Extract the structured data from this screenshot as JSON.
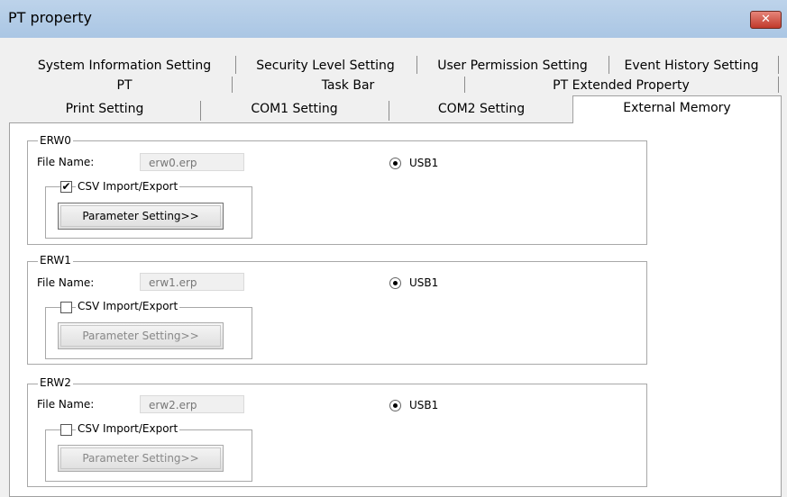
{
  "window": {
    "title": "PT property",
    "close_label": "✕"
  },
  "tabs": {
    "row1": [
      "System Information Setting",
      "Security Level Setting",
      "User Permission Setting",
      "Event History Setting"
    ],
    "row2": [
      "PT",
      "Task Bar",
      "PT Extended Property"
    ],
    "row3": [
      "Print Setting",
      "COM1 Setting",
      "COM2 Setting",
      "External Memory"
    ],
    "active": "External Memory"
  },
  "groups": [
    {
      "title": "ERW0",
      "file_label": "File Name:",
      "file_value": "erw0.erp",
      "radio_label": "USB1",
      "radio_checked": true,
      "csv_label": "CSV Import/Export",
      "csv_checked": true,
      "button_label": "Parameter Setting>>",
      "button_enabled": true
    },
    {
      "title": "ERW1",
      "file_label": "File Name:",
      "file_value": "erw1.erp",
      "radio_label": "USB1",
      "radio_checked": true,
      "csv_label": "CSV Import/Export",
      "csv_checked": false,
      "button_label": "Parameter Setting>>",
      "button_enabled": false
    },
    {
      "title": "ERW2",
      "file_label": "File Name:",
      "file_value": "erw2.erp",
      "radio_label": "USB1",
      "radio_checked": true,
      "csv_label": "CSV Import/Export",
      "csv_checked": false,
      "button_label": "Parameter Setting>>",
      "button_enabled": false
    }
  ],
  "icons": {
    "checkmark": "check-icon",
    "radio_dot": "radio-dot-icon"
  }
}
